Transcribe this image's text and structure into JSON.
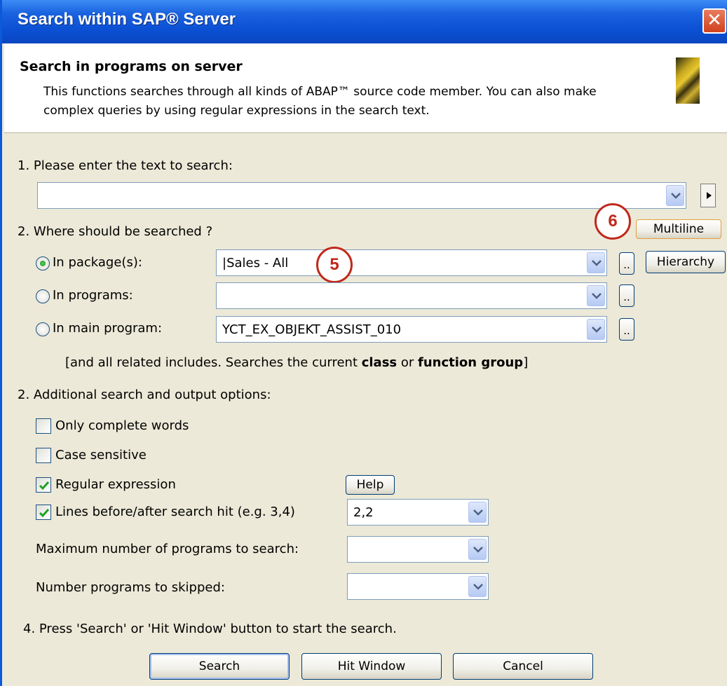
{
  "window": {
    "title": "Search within SAP® Server",
    "close_label": "✕"
  },
  "header": {
    "title": "Search in programs on server",
    "description": "This functions searches through all kinds of ABAP™ source code member. You can also make complex queries by using regular expressions in the search text."
  },
  "step1": {
    "label": "1. Please enter the text to search:",
    "value": ""
  },
  "step2": {
    "label": "2. Where should be searched ?",
    "multiline_label": "Multiline",
    "options": [
      {
        "label": "In package(s):",
        "selected": true,
        "value": "|Sales - All"
      },
      {
        "label": "In programs:",
        "selected": false,
        "value": ""
      },
      {
        "label": "In main program:",
        "selected": false,
        "value": "YCT_EX_OBJEKT_ASSIST_010"
      }
    ],
    "hierarchy_label": "Hierarchy",
    "browse_label": "..",
    "note_pre": "[and all related includes. Searches the current ",
    "note_bold1": "class",
    "note_mid": " or ",
    "note_bold2": "function group",
    "note_post": "]"
  },
  "step3": {
    "label": "2. Additional search and output options:",
    "only_complete_words": {
      "label": "Only complete words",
      "checked": false
    },
    "case_sensitive": {
      "label": "Case sensitive",
      "checked": false
    },
    "regular_expression": {
      "label": "Regular expression",
      "checked": true
    },
    "help_label": "Help",
    "lines_before_after": {
      "label": "Lines before/after search hit (e.g. 3,4)",
      "checked": true,
      "value": "2,2"
    },
    "max_programs": {
      "label": "Maximum number of programs to search:",
      "value": ""
    },
    "skip_programs": {
      "label": "Number programs to skipped:",
      "value": ""
    }
  },
  "step4": {
    "label": "4. Press 'Search' or 'Hit Window' button to start the search."
  },
  "buttons": {
    "search": "Search",
    "hit_window": "Hit Window",
    "cancel": "Cancel"
  },
  "callouts": {
    "five": "5",
    "six": "6"
  },
  "colors": {
    "title_bar": "#0b4fd3",
    "callout": "#c0281a",
    "dialog_bg": "#ece9d8"
  }
}
